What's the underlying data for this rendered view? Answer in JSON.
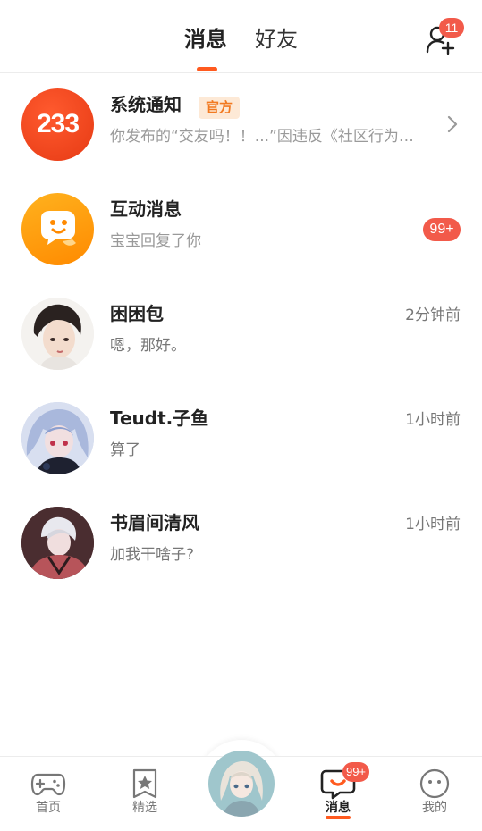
{
  "header": {
    "tabs": [
      {
        "label": "消息",
        "active": true
      },
      {
        "label": "好友",
        "active": false
      }
    ],
    "add_friend_badge": "11"
  },
  "conversations": [
    {
      "name": "系统通知",
      "tag": "官方",
      "preview": "你发布的“交友吗！！...”因违反《社区行为守则》",
      "avatar_text": "233"
    },
    {
      "name": "互动消息",
      "preview": "宝宝回复了你",
      "badge": "99+"
    },
    {
      "name": "困困包",
      "preview": "嗯，那好。",
      "time": "2分钟前"
    },
    {
      "name": "Teudt.子鱼",
      "preview": "算了",
      "time": "1小时前"
    },
    {
      "name": "书眉间清风",
      "preview": "加我干啥子?",
      "time": "1小时前"
    }
  ],
  "nav": {
    "items": [
      {
        "label": "首页",
        "active": false
      },
      {
        "label": "精选",
        "active": false
      },
      {
        "label": "消息",
        "active": true,
        "badge": "99+"
      },
      {
        "label": "我的",
        "active": false
      }
    ]
  },
  "colors": {
    "accent": "#ff5a1f",
    "badge": "#f25a4a",
    "official_bg": "#fde9d6"
  }
}
